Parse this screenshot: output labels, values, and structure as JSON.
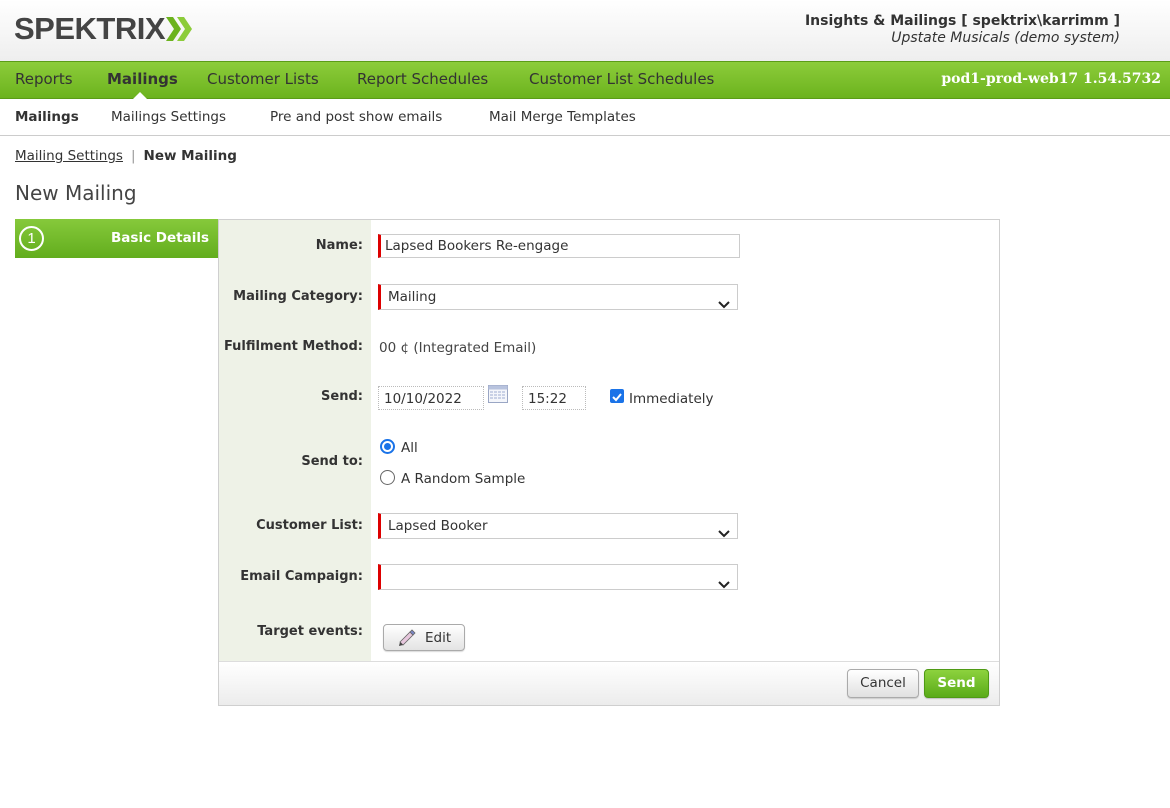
{
  "app": {
    "logo_text": "SPEKTRIX",
    "user_line1": "Insights & Mailings [ spektrix\\karrimm ]",
    "user_line2": "Upstate Musicals (demo system)",
    "server": "pod1-prod-web17 1.54.5732"
  },
  "main_nav": {
    "items": [
      {
        "label": "Reports"
      },
      {
        "label": "Mailings",
        "active": true
      },
      {
        "label": "Customer Lists"
      },
      {
        "label": "Report Schedules"
      },
      {
        "label": "Customer List Schedules"
      }
    ]
  },
  "sub_nav": {
    "items": [
      {
        "label": "Mailings",
        "active": true
      },
      {
        "label": "Mailings Settings"
      },
      {
        "label": "Pre and post show emails"
      },
      {
        "label": "Mail Merge Templates"
      }
    ]
  },
  "breadcrumb": {
    "link": "Mailing Settings",
    "separator": "|",
    "current": "New Mailing"
  },
  "page": {
    "title": "New Mailing"
  },
  "wizard": {
    "step_number": "1",
    "step_label": "Basic Details"
  },
  "form": {
    "name": {
      "label": "Name:",
      "value": "Lapsed Bookers Re-engage"
    },
    "category": {
      "label": "Mailing Category:",
      "value": "Mailing"
    },
    "fulfilment": {
      "label": "Fulfilment Method:",
      "value": "00 ¢ (Integrated Email)"
    },
    "send": {
      "label": "Send:",
      "date": "10/10/2022",
      "time": "15:22",
      "immediately_label": "Immediately",
      "immediately_checked": true
    },
    "send_to": {
      "label": "Send to:",
      "options": [
        "All",
        "A Random Sample"
      ],
      "selected": "All"
    },
    "customer_list": {
      "label": "Customer List:",
      "value": "Lapsed Booker"
    },
    "email_campaign": {
      "label": "Email Campaign:",
      "value": ""
    },
    "target_events": {
      "label": "Target events:",
      "edit_label": "Edit"
    }
  },
  "footer": {
    "cancel_label": "Cancel",
    "send_label": "Send"
  },
  "colors": {
    "brand_green": "#6cb31e",
    "required_marker": "#dd0000",
    "label_column_bg": "#eef2e7"
  }
}
